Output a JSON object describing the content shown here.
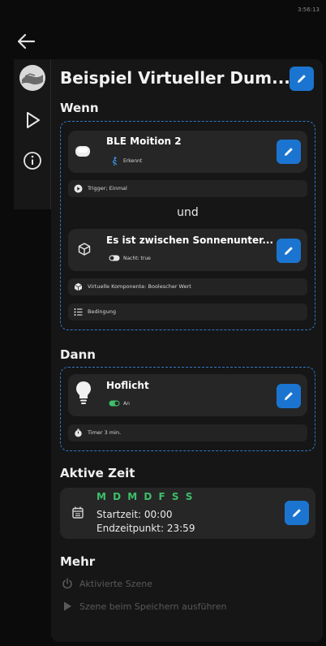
{
  "statusbar": {
    "time": "3:56:13"
  },
  "scene": {
    "title": "Beispiel Virtueller Dum..."
  },
  "sections": {
    "wenn": "Wenn",
    "dann": "Dann",
    "aktive_zeit": "Aktive Zeit",
    "mehr": "Mehr"
  },
  "wenn": {
    "card1": {
      "title": "BLE Moition 2",
      "badge": "Erkennt"
    },
    "trigger": "Trigger; Einmal",
    "und": "und",
    "card2": {
      "title": "Es ist zwischen Sonnenunter...",
      "badge": "Nacht: true"
    },
    "virtual": "Virtuelle Komponente: Boolescher Wert",
    "bedingung": "Bedingung"
  },
  "dann": {
    "card": {
      "title": "Hoflicht",
      "badge": "An"
    },
    "timer": "Timer 3 min."
  },
  "aktive_zeit": {
    "days": "M D M D F S S",
    "start": "Startzeit: 00:00",
    "end": "Endzeitpunkt: 23:59"
  },
  "mehr": {
    "aktivierte": "Aktivierte Szene",
    "ausfuehren": "Szene beim Speichern ausführen"
  },
  "colors": {
    "accent": "#1b75d0",
    "days_green": "#3dbf6a",
    "dashed_border": "#2f78c8"
  }
}
